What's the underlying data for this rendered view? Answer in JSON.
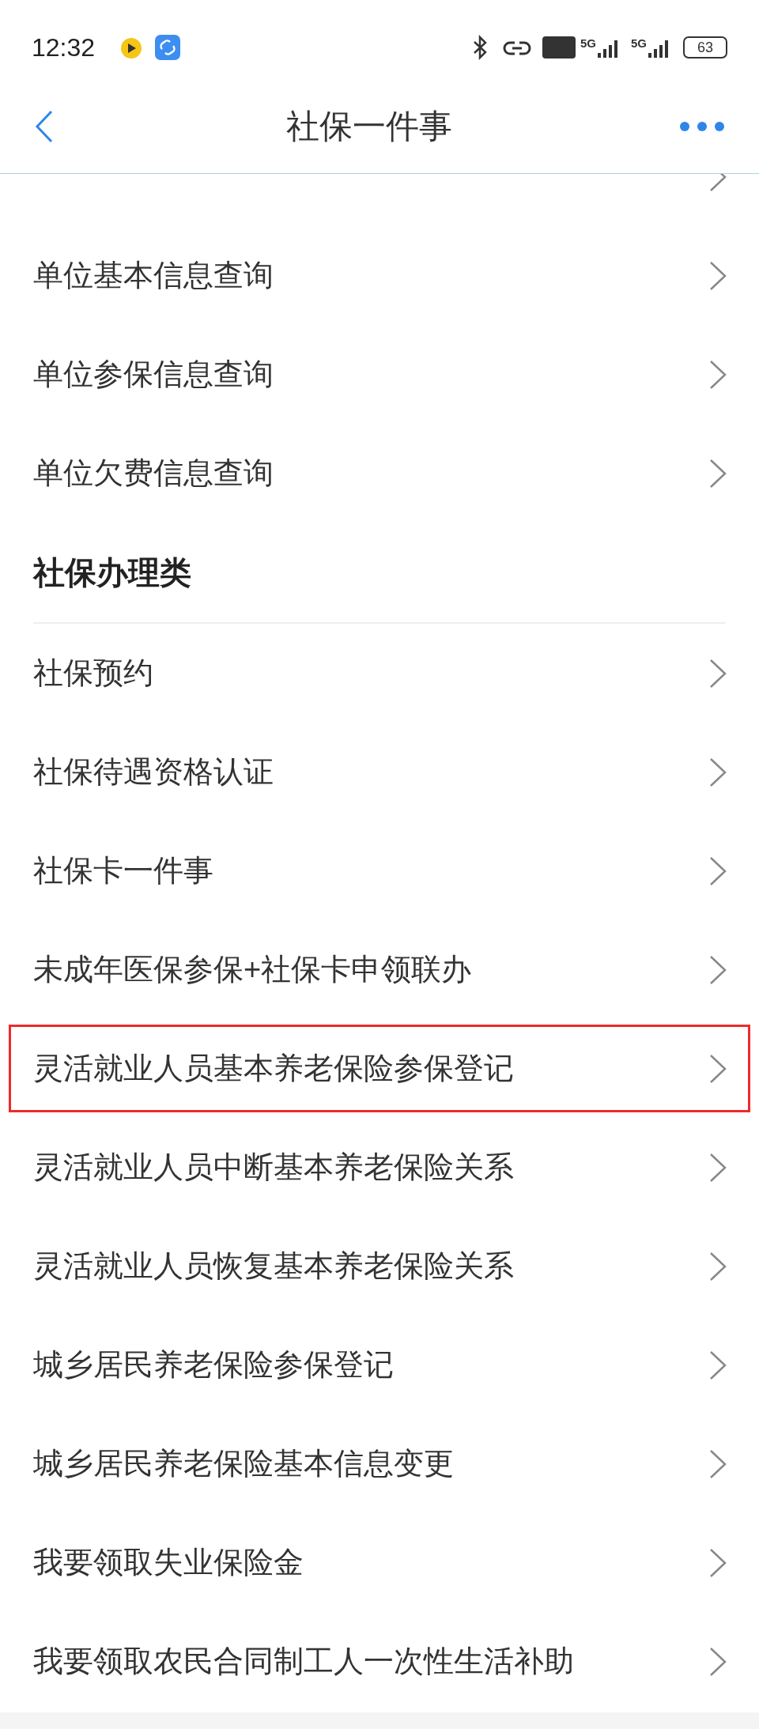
{
  "status_bar": {
    "time": "12:32",
    "network_1": "5G",
    "network_2": "5G",
    "battery": "63"
  },
  "nav": {
    "title": "社保一件事"
  },
  "sections": [
    {
      "items": [
        {
          "highlighted": false
        },
        {
          "label": "单位基本信息查询",
          "highlighted": false
        },
        {
          "label": "单位参保信息查询",
          "highlighted": false
        },
        {
          "label": "单位欠费信息查询",
          "highlighted": false
        }
      ]
    },
    {
      "title": "社保办理类",
      "items": [
        {
          "label": "社保预约",
          "highlighted": false
        },
        {
          "label": "社保待遇资格认证",
          "highlighted": false
        },
        {
          "label": "社保卡一件事",
          "highlighted": false
        },
        {
          "label": "未成年医保参保+社保卡申领联办",
          "highlighted": false
        },
        {
          "label": "灵活就业人员基本养老保险参保登记",
          "highlighted": true
        },
        {
          "label": "灵活就业人员中断基本养老保险关系",
          "highlighted": false
        },
        {
          "label": "灵活就业人员恢复基本养老保险关系",
          "highlighted": false
        },
        {
          "label": "城乡居民养老保险参保登记",
          "highlighted": false
        },
        {
          "label": "城乡居民养老保险基本信息变更",
          "highlighted": false
        },
        {
          "label": "我要领取失业保险金",
          "highlighted": false
        },
        {
          "label": "我要领取农民合同制工人一次性生活补助",
          "highlighted": false
        }
      ]
    }
  ]
}
